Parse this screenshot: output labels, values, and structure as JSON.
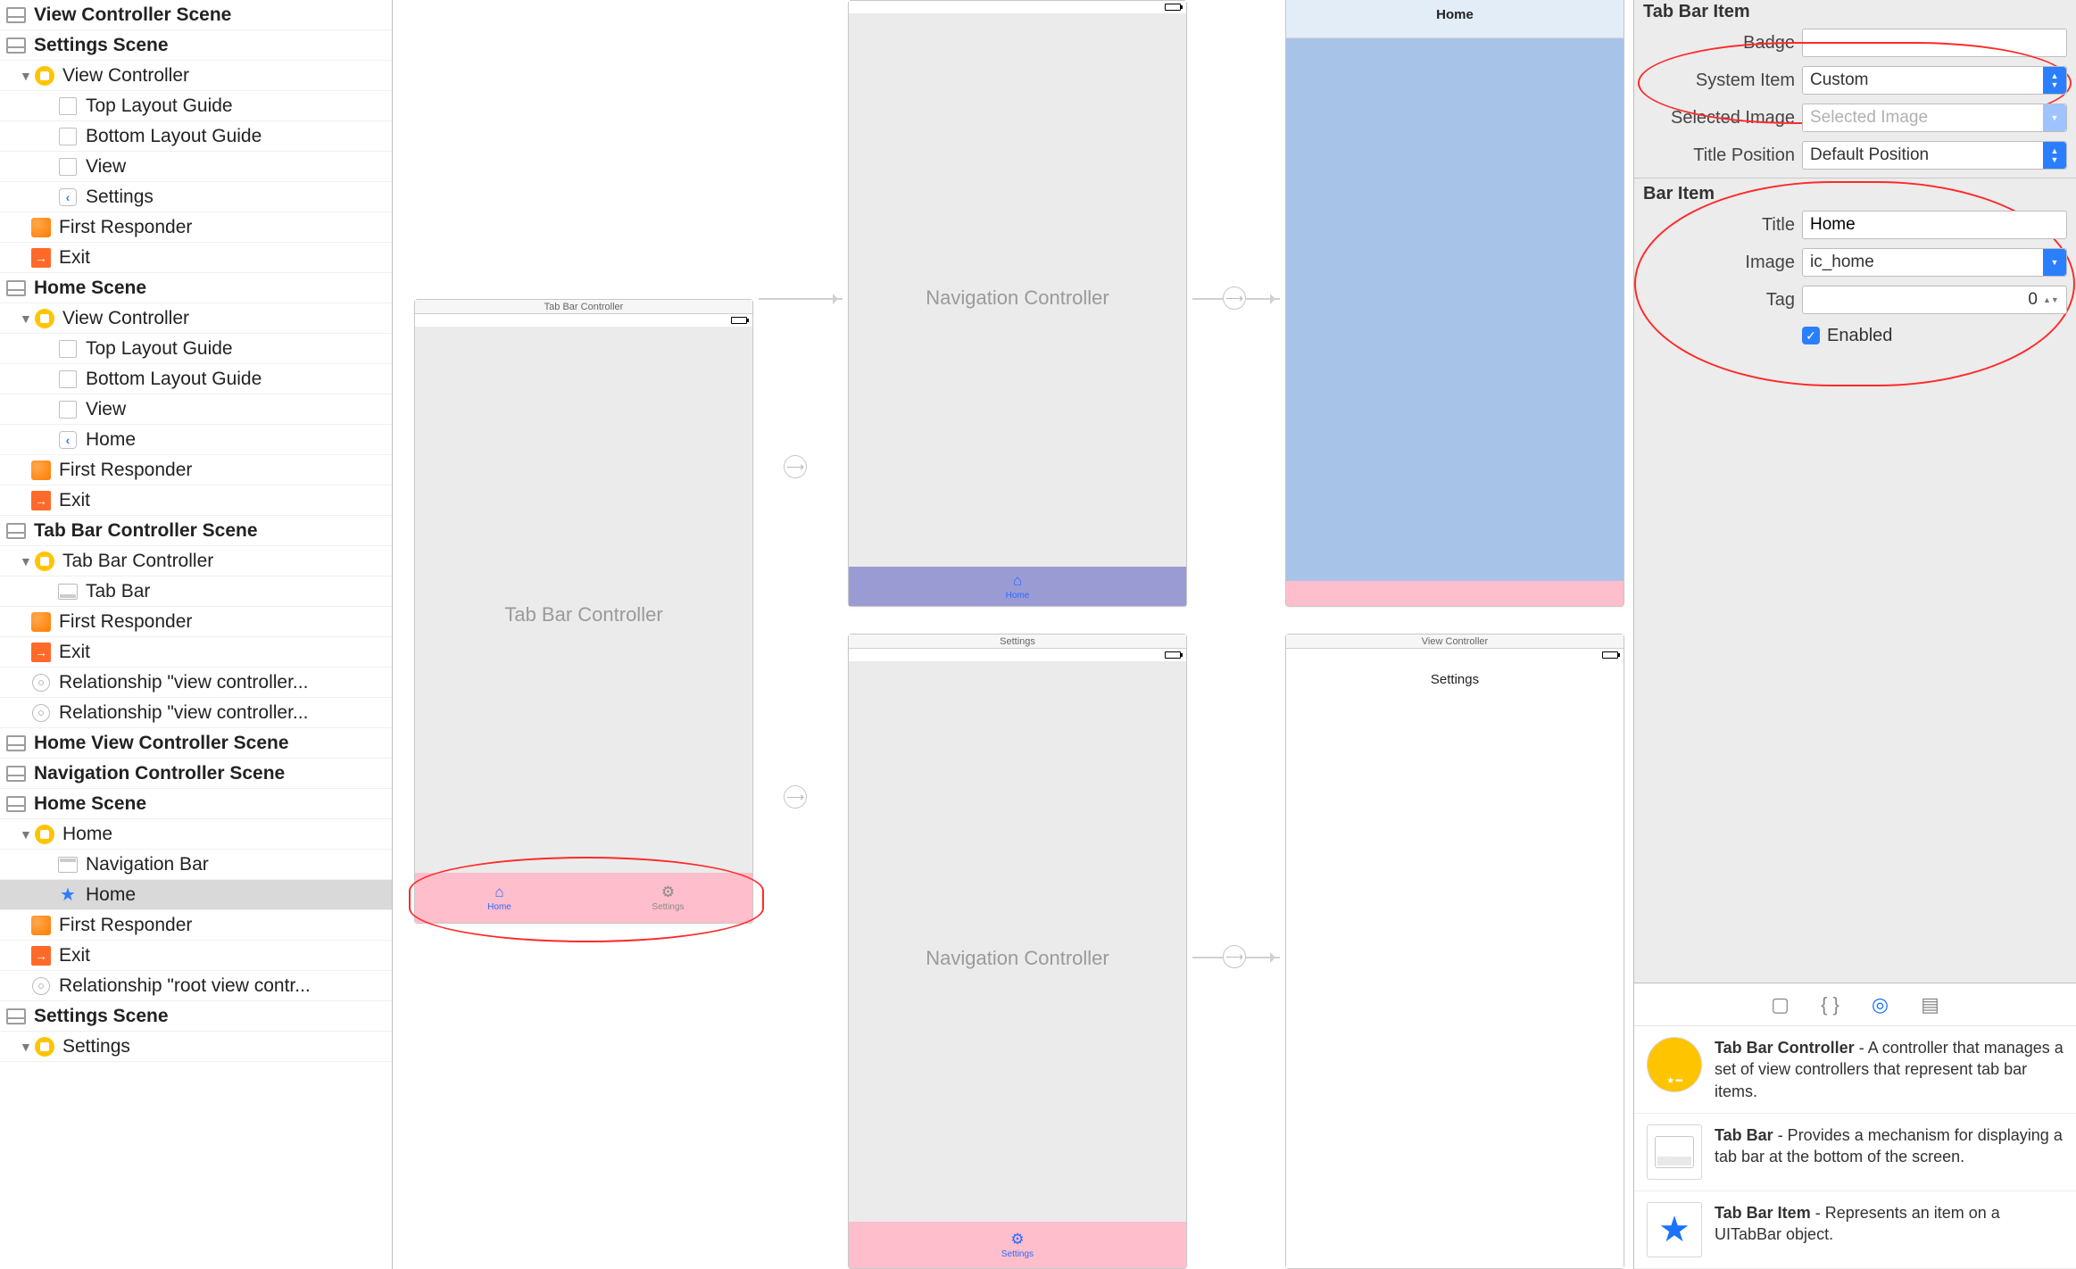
{
  "outline": {
    "scenes": [
      {
        "title": "View Controller Scene",
        "children": []
      },
      {
        "title": "Settings Scene",
        "children": [
          {
            "label": "View Controller",
            "icon": "circle-y",
            "disc": true,
            "indent": 1
          },
          {
            "label": "Top Layout Guide",
            "icon": "square",
            "indent": 3
          },
          {
            "label": "Bottom Layout Guide",
            "icon": "square",
            "indent": 3
          },
          {
            "label": "View",
            "icon": "square",
            "indent": 3
          },
          {
            "label": "Settings",
            "icon": "back",
            "indent": 3
          },
          {
            "label": "First Responder",
            "icon": "cube",
            "indent": 2
          },
          {
            "label": "Exit",
            "icon": "exit",
            "indent": 2
          }
        ]
      },
      {
        "title": "Home Scene",
        "children": [
          {
            "label": "View Controller",
            "icon": "circle-y",
            "disc": true,
            "indent": 1
          },
          {
            "label": "Top Layout Guide",
            "icon": "square",
            "indent": 3
          },
          {
            "label": "Bottom Layout Guide",
            "icon": "square",
            "indent": 3
          },
          {
            "label": "View",
            "icon": "square",
            "indent": 3
          },
          {
            "label": "Home",
            "icon": "back",
            "indent": 3
          },
          {
            "label": "First Responder",
            "icon": "cube",
            "indent": 2
          },
          {
            "label": "Exit",
            "icon": "exit",
            "indent": 2
          }
        ]
      },
      {
        "title": "Tab Bar Controller Scene",
        "children": [
          {
            "label": "Tab Bar Controller",
            "icon": "circle-y",
            "disc": true,
            "indent": 1
          },
          {
            "label": "Tab Bar",
            "icon": "tabbar",
            "indent": 3
          },
          {
            "label": "First Responder",
            "icon": "cube",
            "indent": 2
          },
          {
            "label": "Exit",
            "icon": "exit",
            "indent": 2
          },
          {
            "label": "Relationship \"view controller...",
            "icon": "rel",
            "indent": 2
          },
          {
            "label": "Relationship \"view controller...",
            "icon": "rel",
            "indent": 2
          }
        ]
      },
      {
        "title": "Home View Controller Scene",
        "children": []
      },
      {
        "title": "Navigation Controller Scene",
        "children": []
      },
      {
        "title": "Home Scene",
        "children": [
          {
            "label": "Home",
            "icon": "circle-y",
            "disc": true,
            "indent": 1
          },
          {
            "label": "Navigation Bar",
            "icon": "nav",
            "indent": 3
          },
          {
            "label": "Home",
            "icon": "star",
            "indent": 3,
            "selected": true
          },
          {
            "label": "First Responder",
            "icon": "cube",
            "indent": 2
          },
          {
            "label": "Exit",
            "icon": "exit",
            "indent": 2
          },
          {
            "label": "Relationship \"root view contr...",
            "icon": "rel",
            "indent": 2
          }
        ]
      },
      {
        "title": "Settings Scene",
        "children": [
          {
            "label": "Settings",
            "icon": "circle-y",
            "disc": true,
            "indent": 1,
            "partial": true
          }
        ]
      }
    ]
  },
  "canvas": {
    "tabbar_scene": {
      "title": "Tab Bar Controller",
      "label": "Tab Bar Controller",
      "tabs": [
        {
          "label": "Home",
          "glyph": "⌂",
          "active": true
        },
        {
          "label": "Settings",
          "glyph": "⚙",
          "active": false
        }
      ]
    },
    "nav_home": {
      "label": "Navigation Controller",
      "tab": {
        "label": "Home",
        "glyph": "⌂"
      }
    },
    "nav_settings": {
      "title": "Settings",
      "label": "Navigation Controller",
      "tab": {
        "label": "Settings",
        "glyph": "⚙"
      }
    },
    "home_vc": {
      "nav_title": "Home"
    },
    "settings_vc": {
      "title": "View Controller",
      "nav_title": "Settings"
    }
  },
  "inspector": {
    "section1": "Tab Bar Item",
    "badge_label": "Badge",
    "badge_value": "",
    "system_label": "System Item",
    "system_value": "Custom",
    "selimg_label": "Selected Image",
    "selimg_placeholder": "Selected Image",
    "titlepos_label": "Title Position",
    "titlepos_value": "Default Position",
    "section2": "Bar Item",
    "title_label": "Title",
    "title_value": "Home",
    "image_label": "Image",
    "image_value": "ic_home",
    "tag_label": "Tag",
    "tag_value": "0",
    "enabled_label": "Enabled",
    "enabled": true,
    "library": [
      {
        "name": "Tab Bar Controller",
        "desc": " - A controller that manages a set of view controllers that represent tab bar items."
      },
      {
        "name": "Tab Bar",
        "desc": " - Provides a mechanism for displaying a tab bar at the bottom of the screen."
      },
      {
        "name": "Tab Bar Item",
        "desc": " - Represents an item on a UITabBar object."
      }
    ]
  }
}
